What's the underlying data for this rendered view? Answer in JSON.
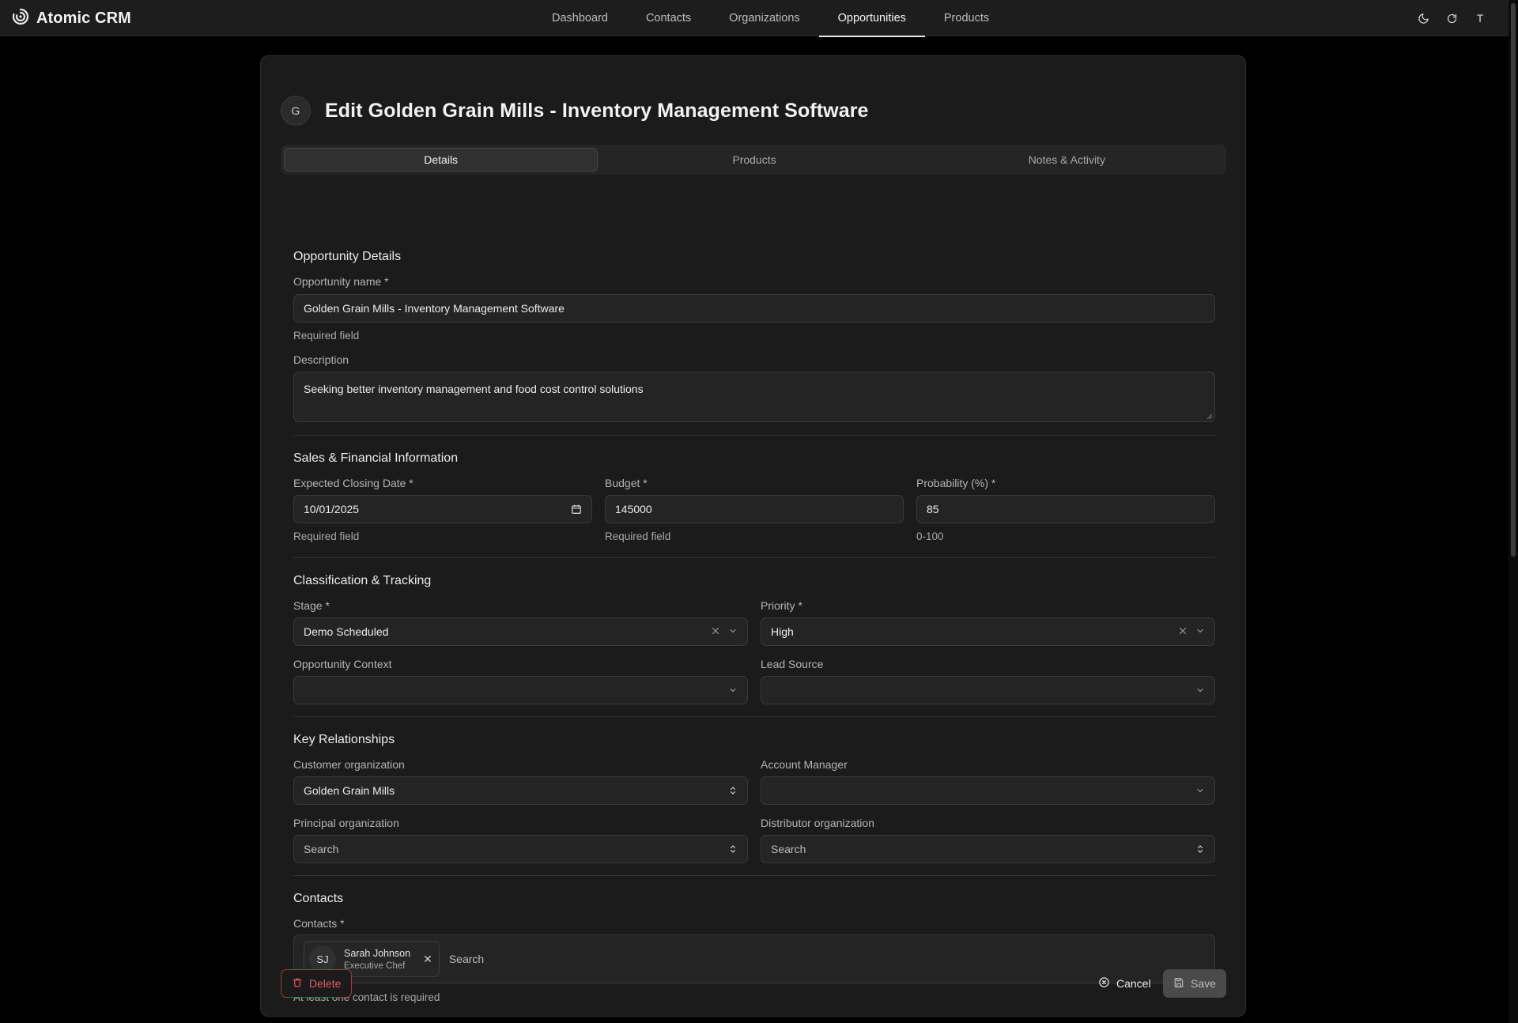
{
  "app": {
    "brand": "Atomic CRM"
  },
  "nav": {
    "items": [
      "Dashboard",
      "Contacts",
      "Organizations",
      "Opportunities",
      "Products"
    ],
    "active": "Opportunities"
  },
  "topbar": {
    "user_initial": "T"
  },
  "page": {
    "avatar_initial": "G",
    "title": "Edit Golden Grain Mills - Inventory Management Software"
  },
  "tabs": [
    {
      "label": "Details",
      "active": true
    },
    {
      "label": "Products",
      "active": false
    },
    {
      "label": "Notes & Activity",
      "active": false
    }
  ],
  "sections": {
    "details": {
      "title": "Opportunity Details",
      "name_label": "Opportunity name *",
      "name_value": "Golden Grain Mills - Inventory Management Software",
      "name_hint": "Required field",
      "description_label": "Description",
      "description_value": "Seeking better inventory management and food cost control solutions"
    },
    "sales": {
      "title": "Sales & Financial Information",
      "closing_label": "Expected Closing Date *",
      "closing_value": "10/01/2025",
      "closing_hint": "Required field",
      "budget_label": "Budget *",
      "budget_value": "145000",
      "budget_hint": "Required field",
      "probability_label": "Probability (%) *",
      "probability_value": "85",
      "probability_hint": "0-100"
    },
    "classification": {
      "title": "Classification & Tracking",
      "stage_label": "Stage *",
      "stage_value": "Demo Scheduled",
      "priority_label": "Priority *",
      "priority_value": "High",
      "context_label": "Opportunity Context",
      "context_value": "",
      "lead_label": "Lead Source",
      "lead_value": ""
    },
    "relationships": {
      "title": "Key Relationships",
      "customer_label": "Customer organization",
      "customer_value": "Golden Grain Mills",
      "manager_label": "Account Manager",
      "manager_value": "",
      "principal_label": "Principal organization",
      "principal_placeholder": "Search",
      "distributor_label": "Distributor organization",
      "distributor_placeholder": "Search"
    },
    "contacts": {
      "title": "Contacts",
      "label": "Contacts *",
      "chips": [
        {
          "initials": "SJ",
          "name": "Sarah Johnson",
          "role": "Executive Chef"
        }
      ],
      "search_placeholder": "Search",
      "hint": "At least one contact is required"
    }
  },
  "footer": {
    "delete_label": "Delete",
    "cancel_label": "Cancel",
    "save_label": "Save"
  },
  "colors": {
    "background": "#000000",
    "card": "#1b1b1b",
    "field": "#242424",
    "danger": "#e25b5b",
    "save_disabled": "#4a4a4a"
  }
}
